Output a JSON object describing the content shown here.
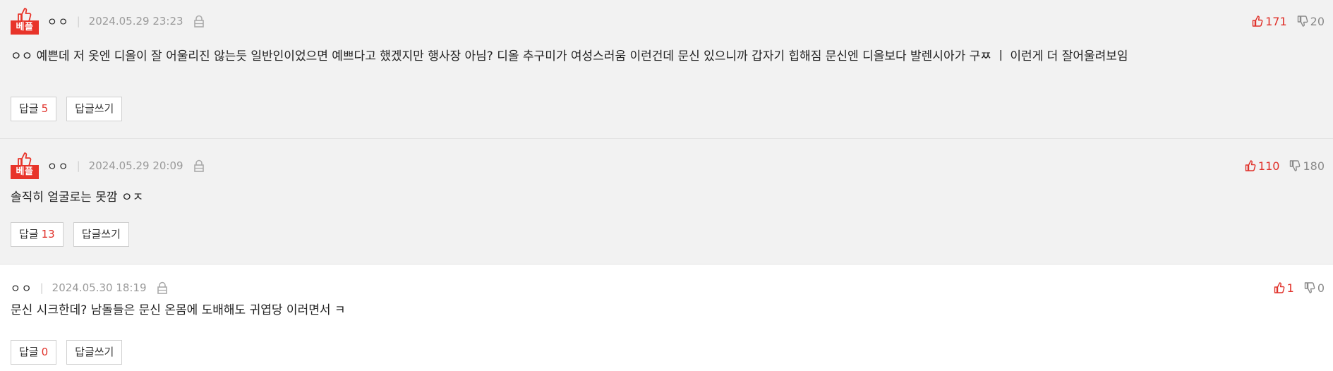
{
  "colors": {
    "accent": "#e8342a",
    "best_bg": "#f2f2f2",
    "normal_bg": "#ffffff",
    "upvote": "#e0312a",
    "downvote": "#8a8a8a",
    "date": "#9a9a9a"
  },
  "comments": [
    {
      "best_badge": "베플",
      "nick": "ㅇㅇ",
      "separator": "|",
      "date": "2024.05.29 23:23",
      "lock_icon": "lock-icon",
      "upvotes": "171",
      "downvotes": "20",
      "text": "ㅇㅇ 예쁜데 저 옷엔 디올이 잘 어울리진 않는듯 일반인이었으면 예쁘다고 했겠지만 행사장 아님? 디올 추구미가 여성스러움 이런건데 문신 있으니까 갑자기 힙해짐 문신엔 디올보다 발렌시아가 구ㅉ ㅣ 이런게 더 잘어울려보임",
      "reply_label": "답글",
      "reply_count": "5",
      "write_reply_label": "답글쓰기"
    },
    {
      "best_badge": "베플",
      "nick": "ㅇㅇ",
      "separator": "|",
      "date": "2024.05.29 20:09",
      "lock_icon": "lock-icon",
      "upvotes": "110",
      "downvotes": "180",
      "text": "솔직히 얼굴로는 못깜 ㅇㅈ",
      "reply_label": "답글",
      "reply_count": "13",
      "write_reply_label": "답글쓰기"
    },
    {
      "nick": "ㅇㅇ",
      "separator": "|",
      "date": "2024.05.30 18:19",
      "lock_icon": "lock-icon",
      "upvotes": "1",
      "downvotes": "0",
      "text": "문신 시크한데? 남돌들은 문신 온몸에 도배해도 귀엽당 이러면서 ㅋ",
      "reply_label": "답글",
      "reply_count": "0",
      "write_reply_label": "답글쓰기"
    }
  ]
}
